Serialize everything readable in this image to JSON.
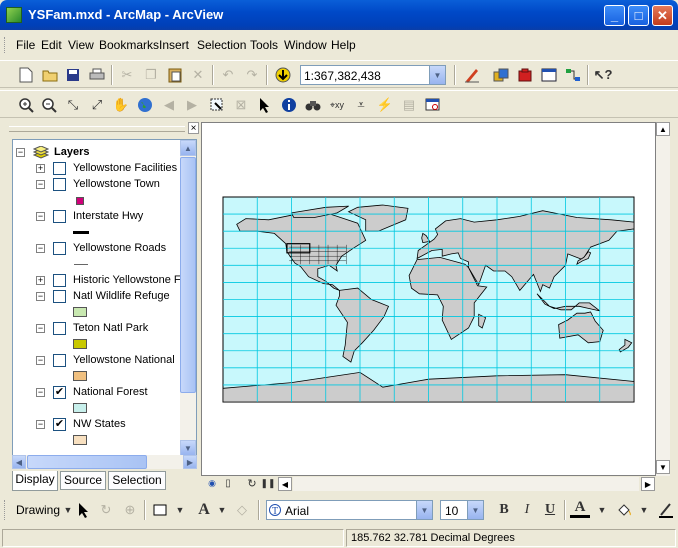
{
  "window": {
    "title": "YSFam.mxd - ArcMap - ArcView",
    "min": "_",
    "max": "□",
    "close": "✕"
  },
  "menu": [
    "File",
    "Edit",
    "View",
    "Bookmarks",
    "Insert",
    "Selection",
    "Tools",
    "Window",
    "Help"
  ],
  "toolbar": {
    "scale": "1:367,382,438"
  },
  "toc": {
    "root_label": "Layers",
    "layers": [
      {
        "name": "Yellowstone Facilities",
        "checked": false,
        "expanded": false
      },
      {
        "name": "Yellowstone Town",
        "checked": false,
        "expanded": true,
        "symbol": "square",
        "color": "#d0007a"
      },
      {
        "name": "Interstate Hwy",
        "checked": false,
        "expanded": true,
        "symbol": "thick-line"
      },
      {
        "name": "Yellowstone Roads",
        "checked": false,
        "expanded": true,
        "symbol": "thin-line"
      },
      {
        "name": "Historic Yellowstone F",
        "checked": false,
        "expanded": false
      },
      {
        "name": "Natl Wildlife Refuge",
        "checked": false,
        "expanded": true,
        "symbol": "fill",
        "color": "#c8e8b0"
      },
      {
        "name": "Teton Natl Park",
        "checked": false,
        "expanded": true,
        "symbol": "fill",
        "color": "#c8c800"
      },
      {
        "name": "Yellowstone National",
        "checked": false,
        "expanded": true,
        "symbol": "fill",
        "color": "#f0c080"
      },
      {
        "name": "National Forest",
        "checked": true,
        "expanded": true,
        "symbol": "fill",
        "color": "#c8f0ec"
      },
      {
        "name": "NW States",
        "checked": true,
        "expanded": true,
        "symbol": "fill",
        "color": "#f8e0c0"
      }
    ],
    "tabs": [
      "Display",
      "Source",
      "Selection"
    ]
  },
  "map": {
    "ocean_color": "#c8f8fc",
    "land_color": "#cccccc",
    "grid_color": "#00c8e0"
  },
  "drawing": {
    "label": "Drawing",
    "text_tool": "A",
    "font": "Arial",
    "size": "10",
    "bold": "B",
    "italic": "I",
    "underline": "U",
    "font_color_glyph": "A"
  },
  "status": {
    "coords": "185.762  32.781 Decimal Degrees"
  }
}
